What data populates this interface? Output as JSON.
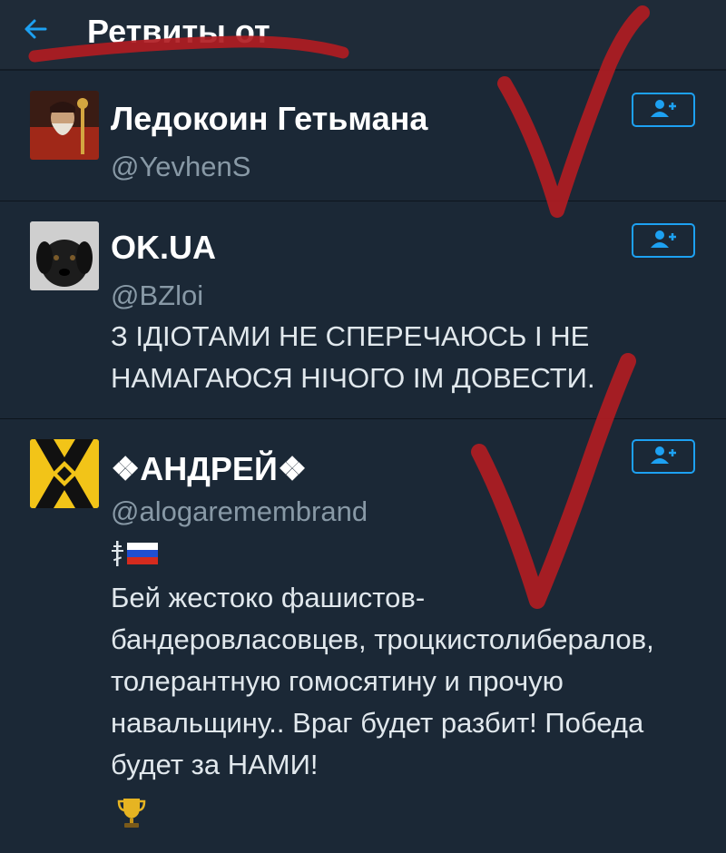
{
  "header": {
    "back_icon": "arrow-left-icon",
    "title": "Ретвиты от"
  },
  "users": [
    {
      "name": "Ледокоин Гетьмана",
      "handle": "@YevhenS",
      "bio": ""
    },
    {
      "name": "OK.UA",
      "handle": "@BZloi",
      "bio_line1": "З ІДІОТАМИ НЕ СПЕРЕЧАЮСЬ І НЕ",
      "bio_line2": "НАМАГАЮСЯ НІЧОГО ІМ ДОВЕСТИ."
    },
    {
      "name": "❖АНДРЕЙ❖",
      "handle": "@alogaremembrand",
      "bio_line1": "Бей жестоко фашистов-",
      "bio_line2": "бандеровласовцев, троцкистолибералов,",
      "bio_line3": "толерантную гомосятину и прочую",
      "bio_line4": "навальщину.. Враг будет разбит! Победа",
      "bio_line5": "будет за НАМИ!"
    }
  ],
  "colors": {
    "background": "#1b2836",
    "accent": "#1da1f2",
    "annotation": "#b01c22"
  },
  "icons": {
    "follow": "add-user-icon",
    "cross_flag": "orthodox-cross-icon",
    "russia_flag": "russia-flag-icon",
    "trophy": "trophy-icon"
  }
}
